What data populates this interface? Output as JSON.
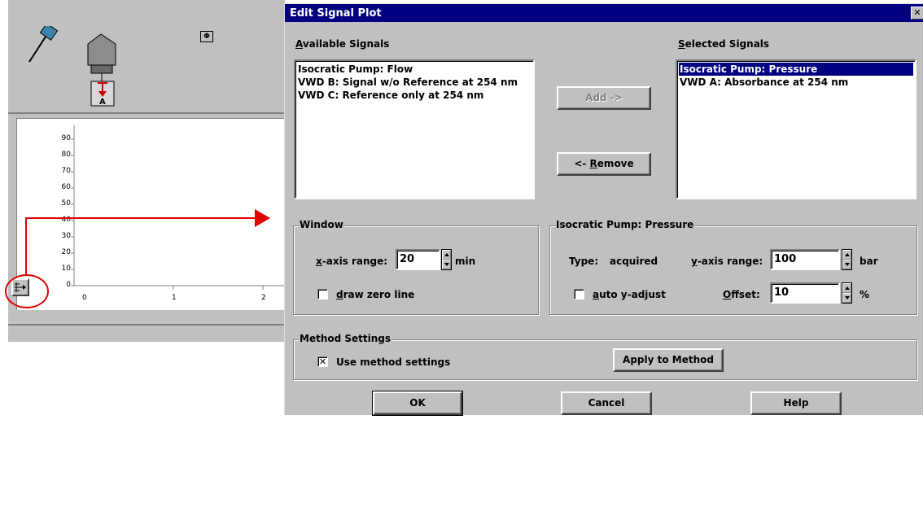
{
  "background": {
    "y_ticks": [
      "90",
      "80",
      "70",
      "60",
      "50",
      "40",
      "30",
      "20",
      "10",
      "0"
    ],
    "x_ticks": [
      "0",
      "1",
      "2"
    ]
  },
  "dialog": {
    "title": "Edit Signal Plot",
    "available_label": "Available Signals",
    "available_items": [
      "Isocratic Pump: Flow",
      "VWD B: Signal w/o Reference at 254 nm",
      "VWD C: Reference only at 254 nm"
    ],
    "selected_label": "Selected Signals",
    "selected_items": [
      "Isocratic Pump: Pressure",
      "VWD A: Absorbance at 254 nm"
    ],
    "add_button": "Add ->",
    "remove_button": "<- Remove",
    "window_group": {
      "title": "Window",
      "x_range_label": "x-axis range:",
      "x_range_value": "20",
      "x_unit": "min",
      "draw_zero_label": "draw zero line",
      "draw_zero_checked": false
    },
    "signal_group": {
      "title": "Isocratic Pump: Pressure",
      "type_label": "Type:",
      "type_value": "acquired",
      "y_range_label": "y-axis range:",
      "y_range_value": "100",
      "y_unit": "bar",
      "auto_label": "auto y-adjust",
      "auto_checked": false,
      "offset_label": "Offset:",
      "offset_value": "10",
      "offset_unit": "%"
    },
    "method_group": {
      "title": "Method Settings",
      "use_label": "Use method settings",
      "use_checked": true,
      "apply_button": "Apply to Method"
    },
    "ok_button": "OK",
    "cancel_button": "Cancel",
    "help_button": "Help"
  },
  "colors": {
    "titlebar": "#000080",
    "selection": "#000080",
    "face": "#c0c0c0",
    "annotation": "#e00000"
  }
}
